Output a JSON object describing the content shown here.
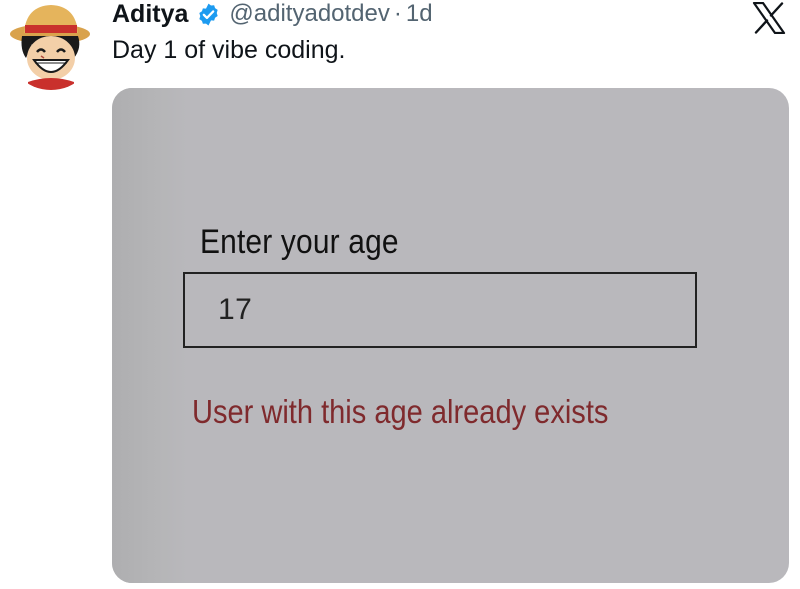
{
  "post": {
    "author": {
      "display_name": "Aditya",
      "handle": "@adityadotdev",
      "verified": true,
      "avatar_icon": "straw-hat-cartoon-avatar"
    },
    "separator": "·",
    "time": "1d",
    "text": "Day 1 of vibe coding.",
    "platform_icon": "x-logo-icon"
  },
  "media": {
    "form": {
      "label": "Enter your age",
      "input_value": "17",
      "error_message": "User with this age already exists"
    }
  },
  "colors": {
    "text_primary": "#0f1419",
    "text_secondary": "#536471",
    "verified_blue": "#1d9bf0",
    "media_background": "#b9b8bc",
    "error_text": "#7f2a2d"
  }
}
